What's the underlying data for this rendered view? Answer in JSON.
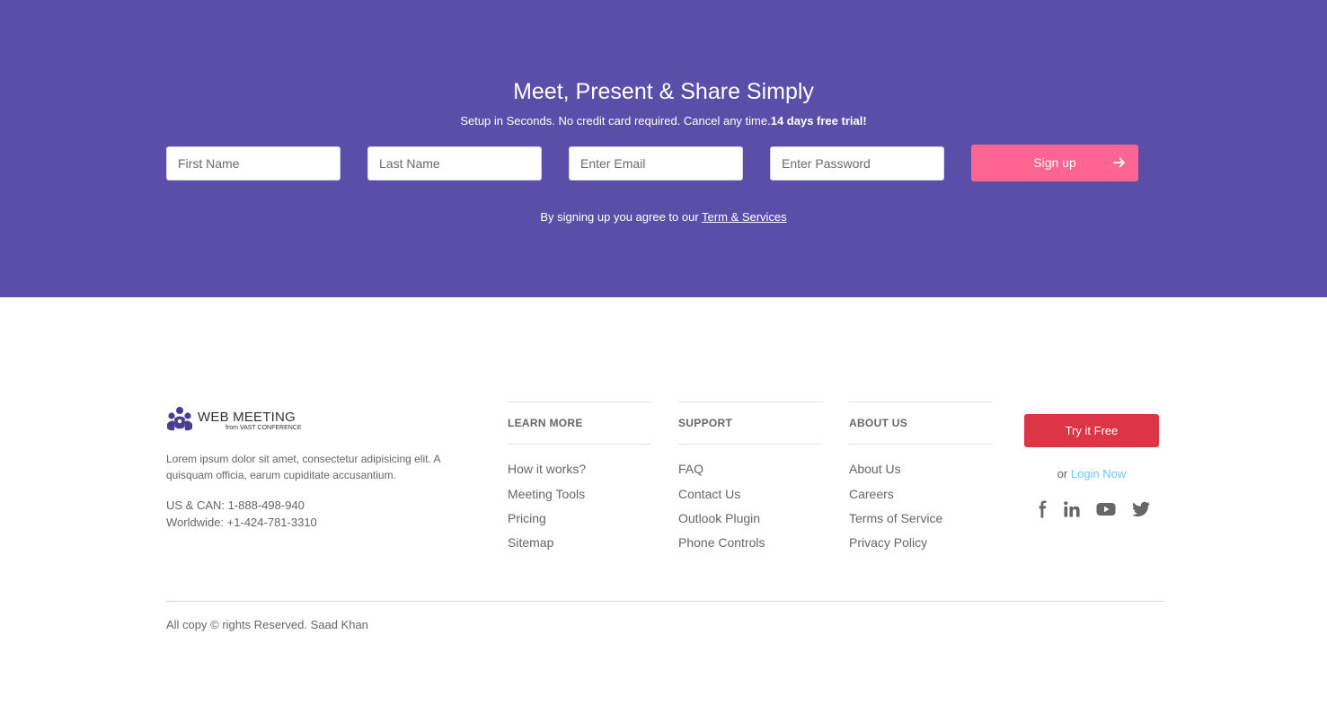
{
  "hero": {
    "title": "Meet, Present & Share Simply",
    "subtitle": "Setup in Seconds. No credit card required. Cancel any time.",
    "subtitle_bold": "14 days free trial!",
    "background": "#5b4ea8",
    "form": {
      "first_name_placeholder": "First Name",
      "last_name_placeholder": "Last Name",
      "email_placeholder": "Enter Email",
      "password_placeholder": "Enter Password",
      "signup_label": "Sign up",
      "signup_color": "#ff6592"
    },
    "agree_text": "By signing up you agree to our ",
    "agree_link": "Term & Services"
  },
  "footer": {
    "logo": {
      "name": "WEB MEETING",
      "sub": "from VAST CONFERENCE",
      "icon": "people-group-icon"
    },
    "about": "Lorem ipsum dolor sit amet, consectetur adipisicing elit. A quisquam officia, earum cupiditate accusantium.",
    "phone_us": "US & CAN: 1-888-498-940",
    "phone_world": "Worldwide: +1-424-781-3310",
    "columns": [
      {
        "heading": "LEARN MORE",
        "links": [
          "How it works?",
          "Meeting Tools",
          "Pricing",
          "Sitemap"
        ]
      },
      {
        "heading": "SUPPORT",
        "links": [
          "FAQ",
          "Contact Us",
          "Outlook Plugin",
          "Phone Controls"
        ]
      },
      {
        "heading": "ABOUT US",
        "links": [
          "About Us",
          "Careers",
          "Terms of Service",
          "Privacy Policy"
        ]
      }
    ],
    "cta": {
      "try_label": "Try it Free",
      "try_color": "#dc3545",
      "or_text": "or ",
      "login_label": "Login Now",
      "login_color": "#6ec8f0"
    },
    "social": [
      "facebook-icon",
      "linkedin-icon",
      "youtube-icon",
      "twitter-icon"
    ],
    "copyright": "All copy © rights Reserved. Saad Khan"
  }
}
